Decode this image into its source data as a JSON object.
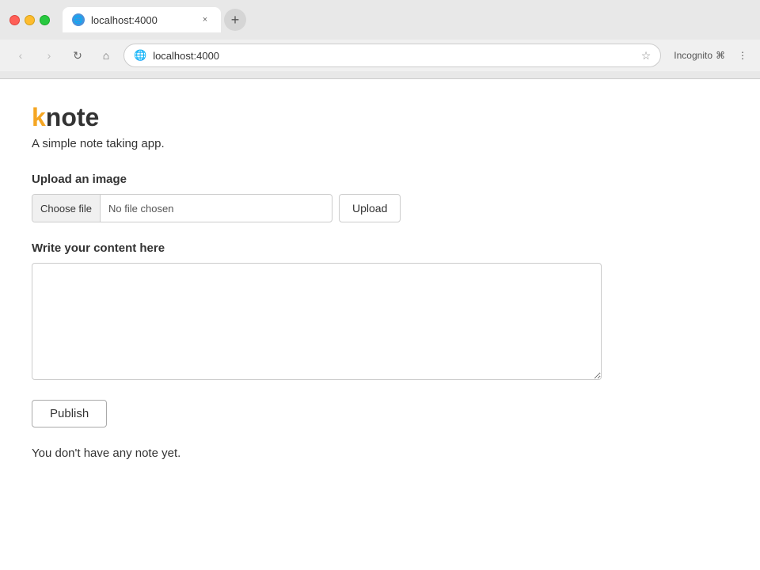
{
  "browser": {
    "url": "localhost:4000",
    "tab_title": "localhost:4000",
    "nav_back_label": "‹",
    "nav_forward_label": "›",
    "nav_refresh_label": "↻",
    "nav_home_label": "⌂",
    "incognito_label": "Incognito",
    "new_tab_label": "+",
    "tab_close_label": "×",
    "favicon_char": "🌐"
  },
  "app": {
    "logo_k": "k",
    "logo_rest": "note",
    "tagline": "A simple note taking app.",
    "upload_section_label": "Upload an image",
    "choose_file_label": "Choose file",
    "no_file_label": "No file chosen",
    "upload_button_label": "Upload",
    "content_section_label": "Write your content here",
    "content_placeholder": "",
    "publish_button_label": "Publish",
    "empty_notes_message": "You don't have any note yet."
  }
}
